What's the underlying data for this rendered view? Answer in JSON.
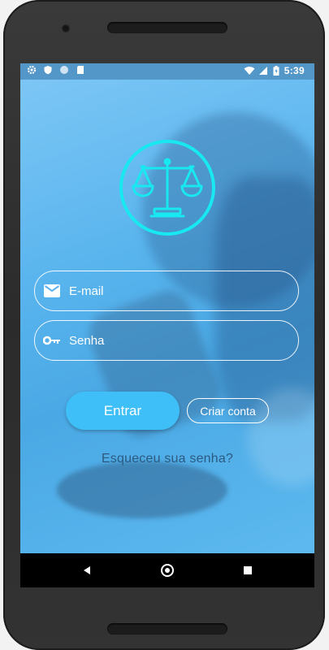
{
  "status_bar": {
    "time": "5:39",
    "left_icons": [
      "gear-icon",
      "shield-icon",
      "circle-icon",
      "sd-card-icon"
    ],
    "right_icons": [
      "wifi-icon",
      "signal-icon",
      "battery-icon"
    ]
  },
  "login": {
    "logo_icon": "scales-of-justice-icon",
    "email_placeholder": "E-mail",
    "password_placeholder": "Senha",
    "login_button": "Entrar",
    "signup_button": "Criar conta",
    "forgot_password": "Esqueceu sua senha?"
  },
  "nav_bar": {
    "buttons": [
      "back-icon",
      "home-icon",
      "recents-icon"
    ]
  },
  "colors": {
    "accent": "#3fbff8",
    "logo": "#18e8f0",
    "status_bar": "#5396c8",
    "forgot_text": "#2c5a80"
  }
}
